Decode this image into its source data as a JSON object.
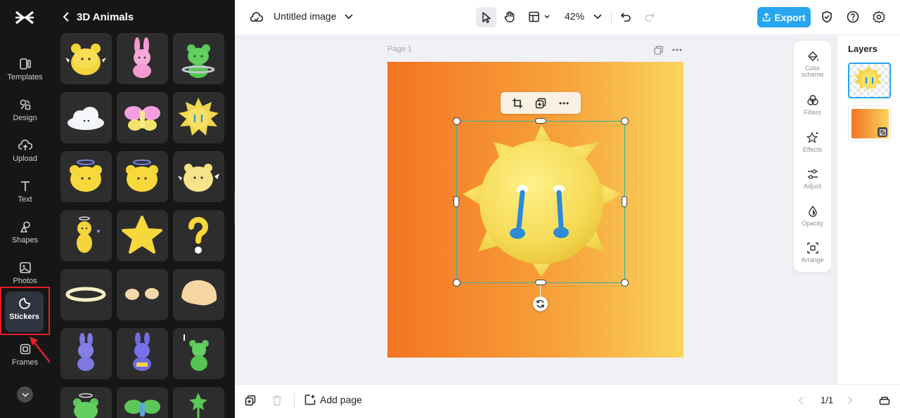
{
  "rail": {
    "items": [
      {
        "label": "Templates",
        "icon": "templates-icon"
      },
      {
        "label": "Design",
        "icon": "design-icon"
      },
      {
        "label": "Upload",
        "icon": "upload-icon"
      },
      {
        "label": "Text",
        "icon": "text-icon"
      },
      {
        "label": "Shapes",
        "icon": "shapes-icon"
      },
      {
        "label": "Photos",
        "icon": "photos-icon"
      },
      {
        "label": "Stickers",
        "icon": "stickers-icon"
      },
      {
        "label": "Frames",
        "icon": "frames-icon"
      }
    ],
    "active": "Stickers",
    "highlight_color": "#e2202a"
  },
  "panel": {
    "title": "3D Animals",
    "stickers": [
      "yellow-bear",
      "pink-bunny",
      "green-frog",
      "white-cloud",
      "pink-butterfly",
      "yellow-sun-crying",
      "angel-yellow-bear",
      "angel-yellow-bear-2",
      "yellow-bear-waving",
      "angel-bear-standing",
      "yellow-star",
      "question-mark",
      "halo-ring",
      "two-eggs",
      "seashell",
      "purple-bunny",
      "purple-bunny-2",
      "green-bear",
      "green-bear-angel",
      "green-butterfly",
      "green-star-wand"
    ]
  },
  "topbar": {
    "doc_title": "Untitled image",
    "zoom": "42%",
    "export_label": "Export",
    "accent": "#26a6f0"
  },
  "canvas": {
    "page_label": "Page 1",
    "background_gradient": [
      "#f47424",
      "#fad45e"
    ],
    "selection_color": "#2bb3a6"
  },
  "right_tools": [
    {
      "label": "Color scheme",
      "icon": "color-scheme-icon"
    },
    {
      "label": "Filters",
      "icon": "filters-icon"
    },
    {
      "label": "Effects",
      "icon": "effects-icon"
    },
    {
      "label": "Adjust",
      "icon": "adjust-icon"
    },
    {
      "label": "Opacity",
      "icon": "opacity-icon"
    },
    {
      "label": "Arrange",
      "icon": "arrange-icon"
    }
  ],
  "layers": {
    "title": "Layers"
  },
  "bottombar": {
    "add_page_label": "Add page",
    "page_count": "1/1"
  }
}
